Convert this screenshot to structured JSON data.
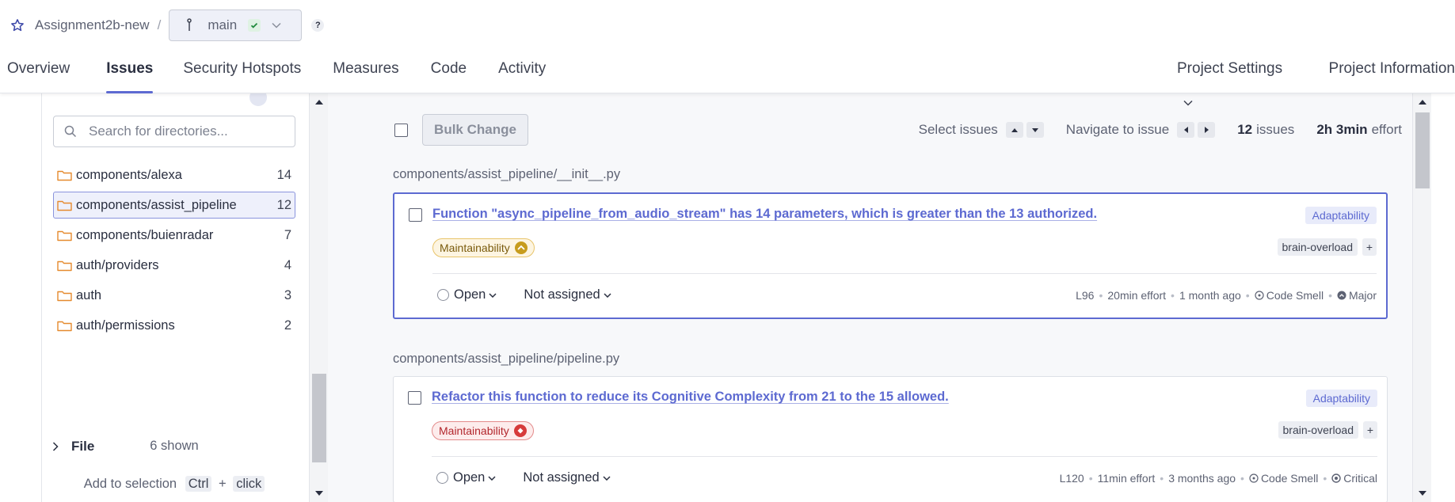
{
  "header": {
    "project_name": "Assignment2b-new",
    "separator": "/",
    "branch": "main",
    "help": "?"
  },
  "nav": {
    "tabs": [
      {
        "label": "Overview"
      },
      {
        "label": "Issues"
      },
      {
        "label": "Security Hotspots"
      },
      {
        "label": "Measures"
      },
      {
        "label": "Code"
      },
      {
        "label": "Activity"
      }
    ],
    "active_tab": "Issues",
    "right": {
      "settings": "Project Settings",
      "information": "Project Information"
    }
  },
  "sidebar": {
    "search_placeholder": "Search for directories...",
    "directories": [
      {
        "name": "components/alexa",
        "count": "14"
      },
      {
        "name": "components/assist_pipeline",
        "count": "12"
      },
      {
        "name": "components/buienradar",
        "count": "7"
      },
      {
        "name": "auth/providers",
        "count": "4"
      },
      {
        "name": "auth",
        "count": "3"
      },
      {
        "name": "auth/permissions",
        "count": "2"
      }
    ],
    "selected_directory": "components/assist_pipeline",
    "shown_label": "6 shown",
    "add_selection": {
      "text": "Add to selection",
      "key1": "Ctrl",
      "plus": "+",
      "key2": "click"
    },
    "file_section": "File"
  },
  "toolbar": {
    "bulk_change": "Bulk Change",
    "select_issues": "Select issues",
    "navigate": "Navigate to issue",
    "issues_count": "12",
    "issues_label": "issues",
    "effort_value": "2h 3min",
    "effort_label": "effort"
  },
  "groups": [
    {
      "path": "components/assist_pipeline/__init__.py",
      "issue": {
        "title": "Function \"async_pipeline_from_audio_stream\" has 14 parameters, which is greater than the 13 authorized.",
        "attribute": "Adaptability",
        "quality": "Maintainability",
        "severity_level": "medium",
        "tag": "brain-overload",
        "tag_plus": "+",
        "status": "Open",
        "assignee": "Not assigned",
        "line": "L96",
        "effort": "20min effort",
        "age": "1 month ago",
        "type": "Code Smell",
        "severity": "Major"
      }
    },
    {
      "path": "components/assist_pipeline/pipeline.py",
      "issue": {
        "title": "Refactor this function to reduce its Cognitive Complexity from 21 to the 15 allowed.",
        "attribute": "Adaptability",
        "quality": "Maintainability",
        "severity_level": "high",
        "tag": "brain-overload",
        "tag_plus": "+",
        "status": "Open",
        "assignee": "Not assigned",
        "line": "L120",
        "effort": "11min effort",
        "age": "3 months ago",
        "type": "Code Smell",
        "severity": "Critical"
      }
    }
  ],
  "colors": {
    "accent": "#5d6ad1",
    "folder": "#e58a2e",
    "medium": "#c79c1d",
    "high": "#d63b3b"
  }
}
